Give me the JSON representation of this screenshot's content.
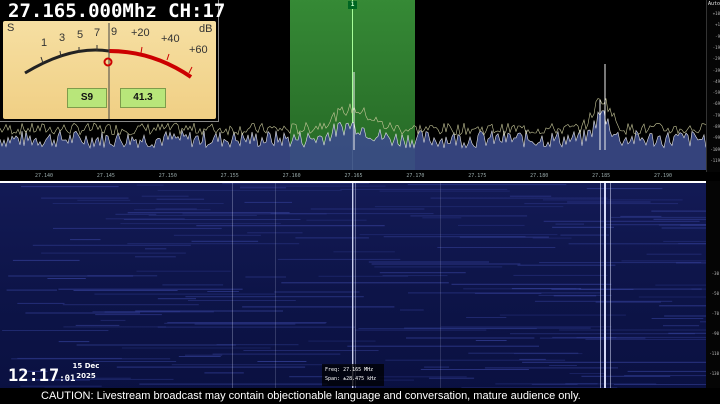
{
  "radio": {
    "frequency_readout": "27.165.000Mhz CH:17"
  },
  "smeter": {
    "scale_labels": [
      "S",
      "1",
      "3",
      "5",
      "7",
      "9",
      "+20",
      "+40",
      "+60",
      "dB"
    ],
    "s_value": "S9",
    "db_value": "41.3",
    "needle_position_fraction": 0.45,
    "colors": {
      "face": "#f4d896",
      "display": "#b8e67a",
      "over_scale": "#cc0000"
    }
  },
  "spectrum": {
    "center_label": "1",
    "auto_label": "Auto",
    "db_scale": [
      "+10",
      "+1",
      "-9",
      "-19",
      "-29",
      "-39",
      "-49",
      "-59",
      "-69",
      "-79",
      "-89",
      "-99",
      "-109",
      "-119"
    ],
    "freq_ticks": [
      "27.140",
      "27.145",
      "27.150",
      "27.155",
      "27.160",
      "27.165",
      "27.170",
      "27.175",
      "27.180",
      "27.185",
      "27.190"
    ],
    "colors": {
      "filter": "#3fa23f",
      "trace": "#c9c9a6",
      "fill": "#5c6ca8"
    }
  },
  "waterfall": {
    "scale_labels": [
      "-30",
      "-50",
      "-70",
      "-90",
      "-110",
      "-130",
      "-150"
    ]
  },
  "cursor_info": {
    "freq_label": "Freq:",
    "freq_value": "27.165 MHz",
    "span_label": "Span:",
    "span_value": "±28.475 kHz"
  },
  "clock": {
    "time": "12:17",
    "seconds": ":01",
    "date_line1": "15 Dec",
    "date_line2": "2025"
  },
  "caution": {
    "text": "CAUTION:  Livestream broadcast may contain objectionable language and conversation, mature audience only."
  }
}
